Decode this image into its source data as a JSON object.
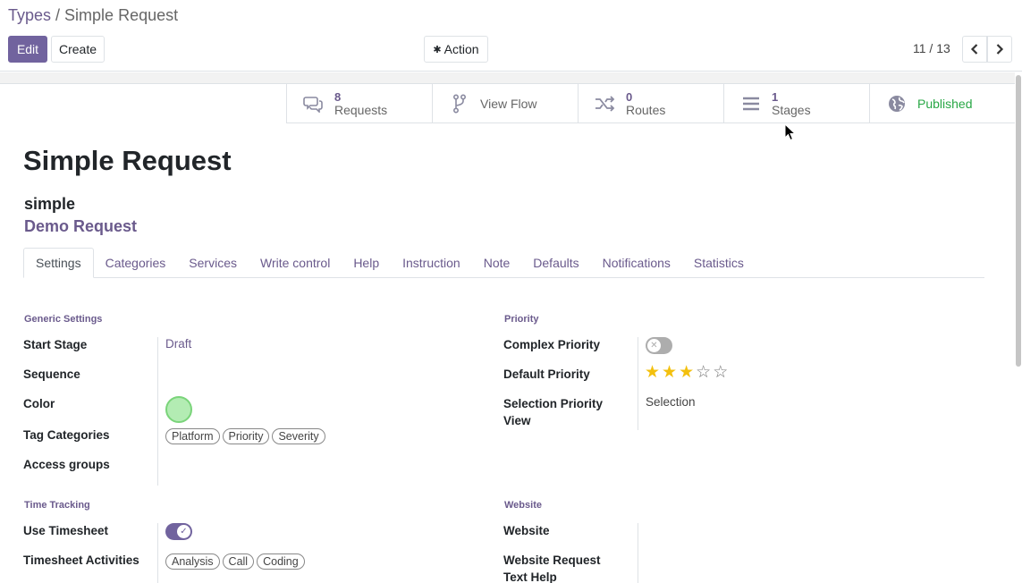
{
  "breadcrumb": {
    "parent": "Types",
    "separator": " / ",
    "current": "Simple Request"
  },
  "toolbar": {
    "edit_label": "Edit",
    "create_label": "Create",
    "action_label": "Action"
  },
  "pager": {
    "value": "11 / 13"
  },
  "stat_buttons": {
    "requests": {
      "value": "8",
      "label": "Requests",
      "icon": "comments-icon"
    },
    "view_flow": {
      "label": "View Flow",
      "icon": "code-fork-icon"
    },
    "routes": {
      "value": "0",
      "label": "Routes",
      "icon": "random-icon"
    },
    "stages": {
      "value": "1",
      "label": "Stages",
      "icon": "bars-icon"
    },
    "published": {
      "label": "Published",
      "icon": "globe-icon",
      "color": "#28a745"
    }
  },
  "record": {
    "title": "Simple Request",
    "code": "simple",
    "kind": "Demo Request"
  },
  "tabs": [
    "Settings",
    "Categories",
    "Services",
    "Write control",
    "Help",
    "Instruction",
    "Note",
    "Defaults",
    "Notifications",
    "Statistics"
  ],
  "generic_settings": {
    "title": "Generic Settings",
    "start_stage_label": "Start Stage",
    "start_stage_value": "Draft",
    "sequence_label": "Sequence",
    "color_label": "Color",
    "color_value": "#b3ecb3",
    "tag_categories_label": "Tag Categories",
    "tag_categories": [
      "Platform",
      "Priority",
      "Severity"
    ],
    "access_groups_label": "Access groups"
  },
  "priority": {
    "title": "Priority",
    "complex_priority_label": "Complex Priority",
    "complex_priority_on": false,
    "default_priority_label": "Default Priority",
    "default_priority_stars": 3,
    "default_priority_max": 5,
    "selection_view_label": "Selection Priority View",
    "selection_view_value": "Selection"
  },
  "time_tracking": {
    "title": "Time Tracking",
    "use_timesheet_label": "Use Timesheet",
    "use_timesheet_on": true,
    "timesheet_activities_label": "Timesheet Activities",
    "activities": [
      "Analysis",
      "Call",
      "Coding"
    ]
  },
  "website": {
    "title": "Website",
    "website_label": "Website",
    "help_label": "Website Request Text Help"
  },
  "colors": {
    "accent": "#71639e",
    "link": "#6a5a8c",
    "published": "#28a745"
  }
}
